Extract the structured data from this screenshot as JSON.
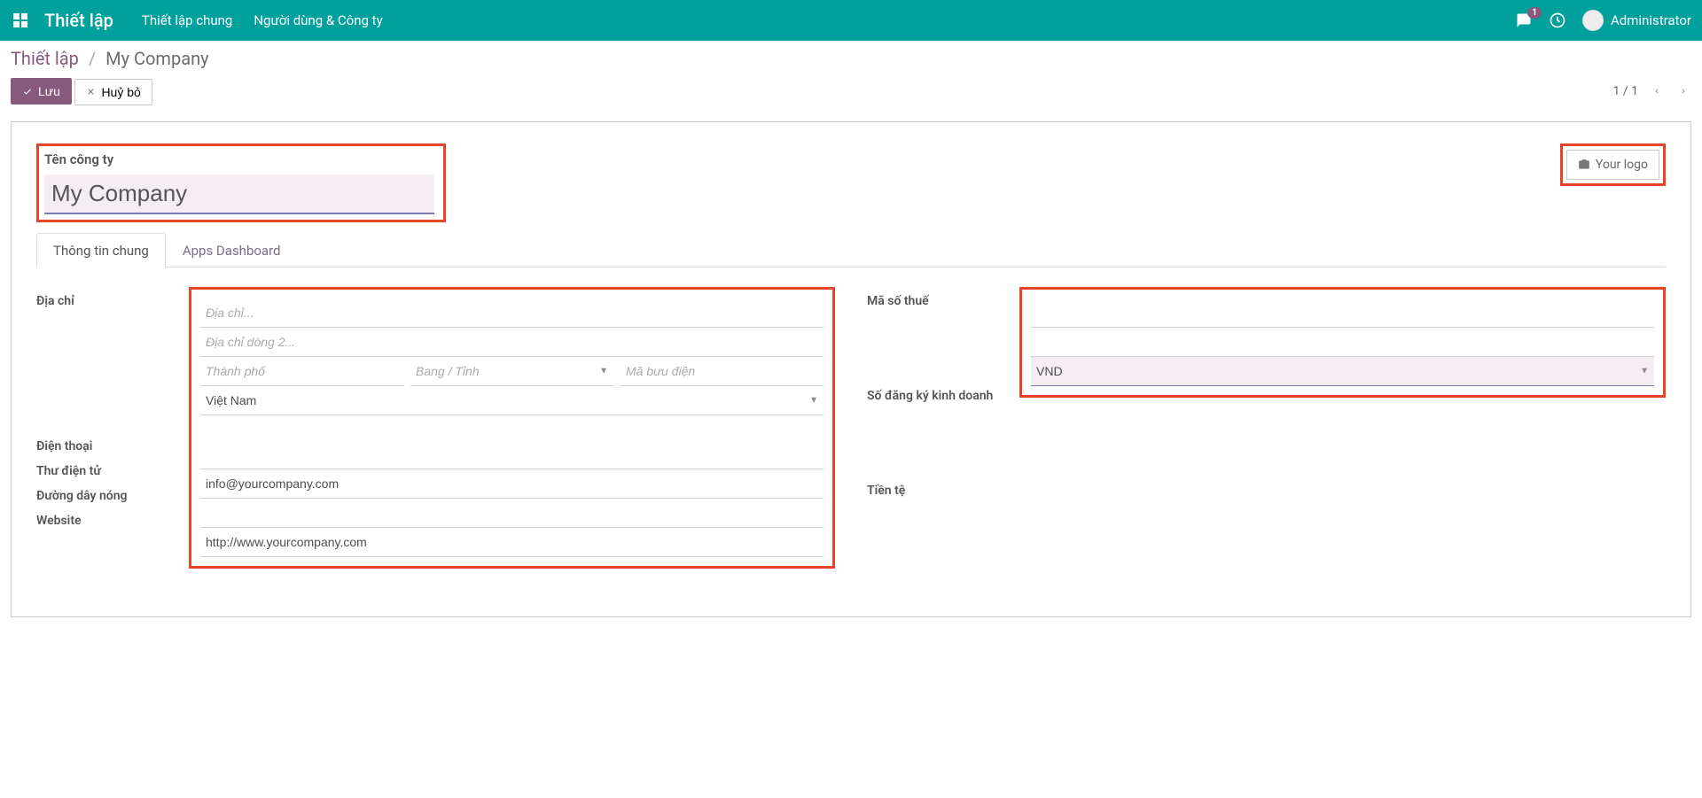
{
  "navbar": {
    "brand": "Thiết lập",
    "links": [
      "Thiết lập chung",
      "Người dùng & Công ty"
    ],
    "badge_count": "1",
    "user_name": "Administrator"
  },
  "breadcrumb": {
    "root": "Thiết lập",
    "current": "My Company"
  },
  "buttons": {
    "save": "Lưu",
    "discard": "Huỷ bỏ"
  },
  "pager": {
    "value": "1 / 1"
  },
  "form": {
    "title_label": "Tên công ty",
    "title_value": "My Company",
    "logo_label": "Your logo",
    "tabs": {
      "general": "Thông tin chung",
      "apps": "Apps Dashboard"
    },
    "labels": {
      "address": "Địa chỉ",
      "phone": "Điện thoại",
      "email": "Thư điện tử",
      "hotline": "Đường dây nóng",
      "website": "Website",
      "vat": "Mã số thuế",
      "registry": "Số đăng ký kinh doanh",
      "currency": "Tiền tệ"
    },
    "placeholders": {
      "street": "Địa chỉ...",
      "street2": "Địa chỉ dòng 2...",
      "city": "Thành phố",
      "state": "Bang / Tỉnh",
      "zip": "Mã bưu điện"
    },
    "values": {
      "country": "Việt Nam",
      "email": "info@yourcompany.com",
      "website": "http://www.yourcompany.com",
      "currency": "VND"
    }
  }
}
